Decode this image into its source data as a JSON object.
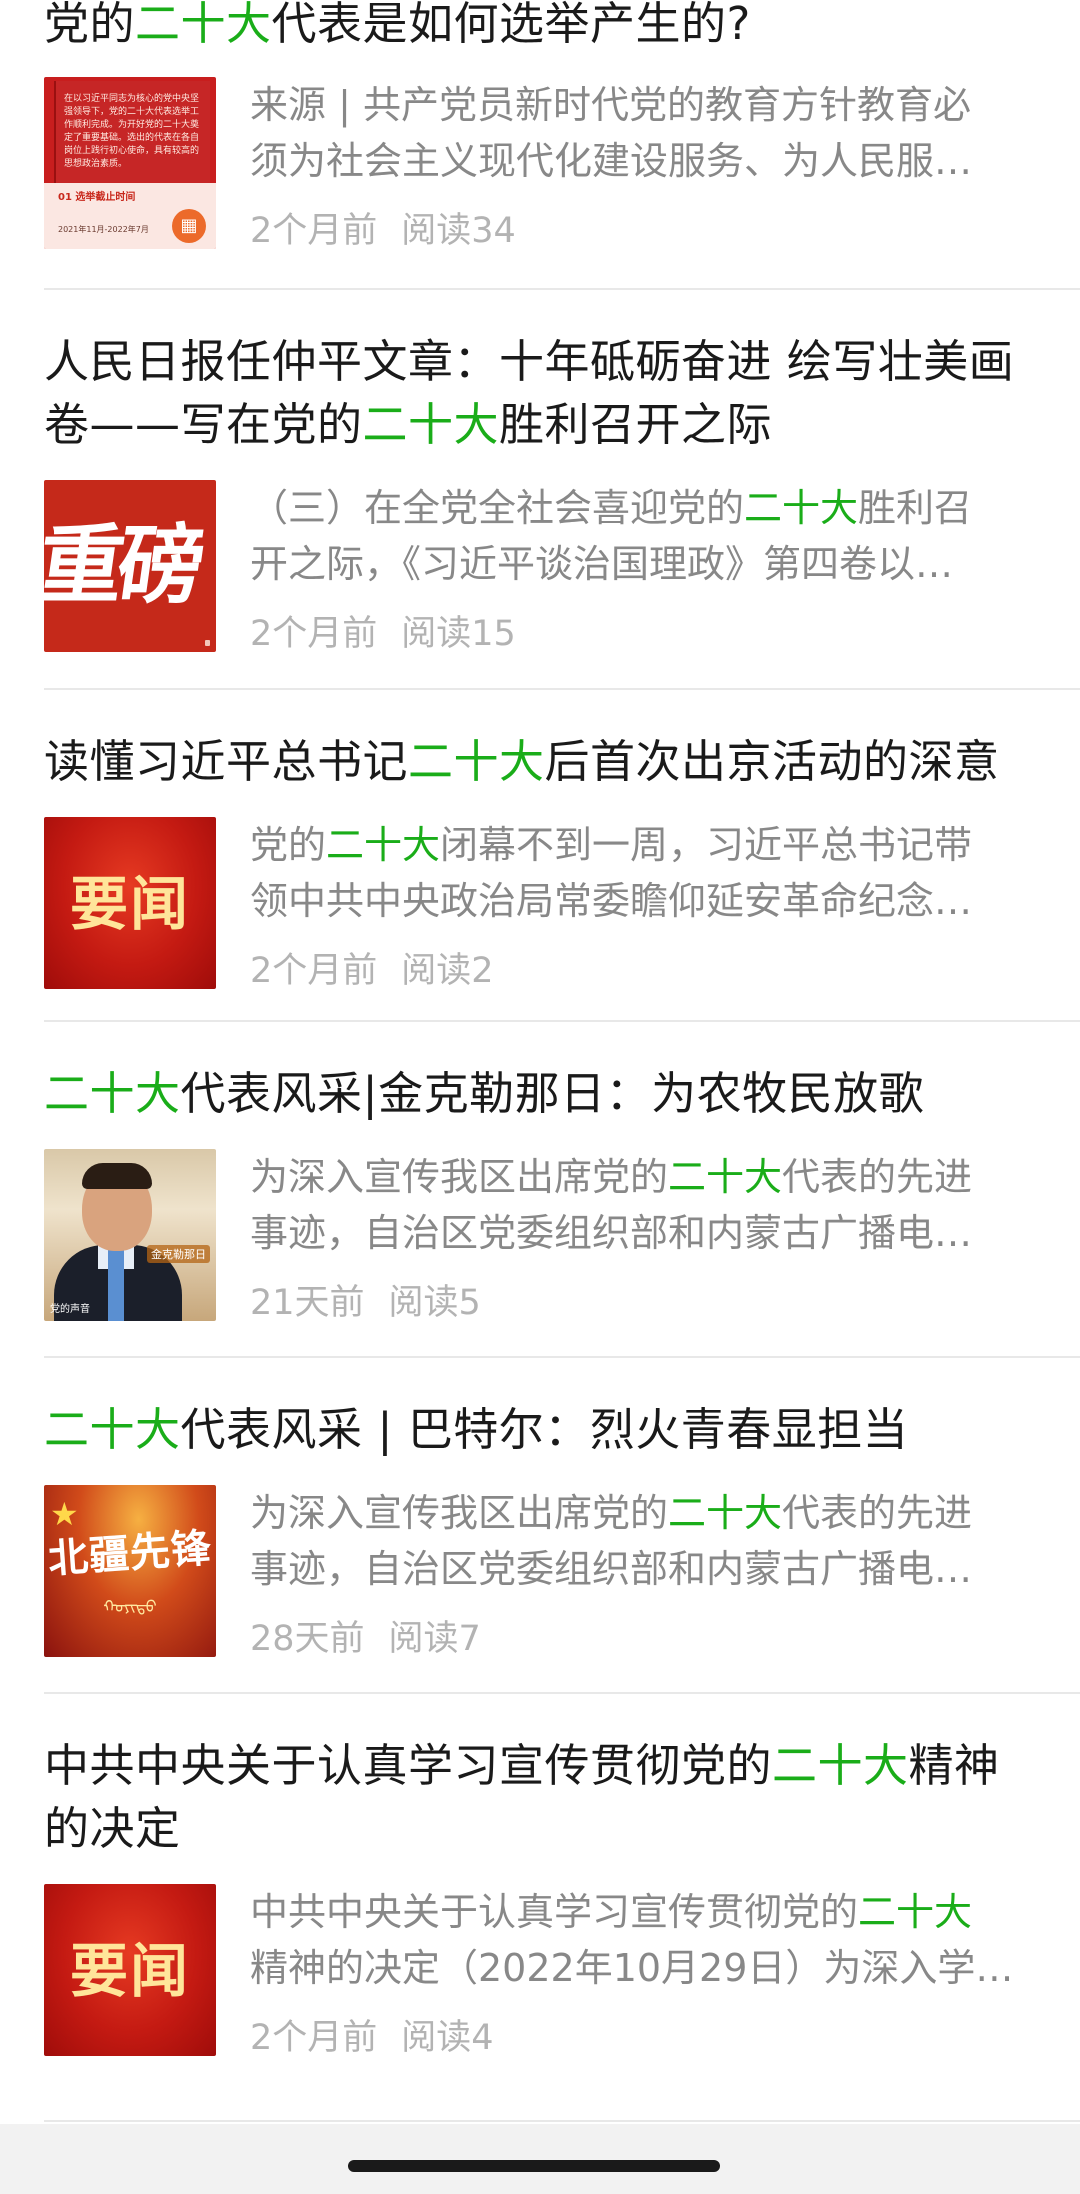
{
  "articles": [
    {
      "title_segments": [
        {
          "text": "党的",
          "hl": false
        },
        {
          "text": "二十大",
          "hl": true
        },
        {
          "text": "代表是如何选举产生的?",
          "hl": false
        }
      ],
      "digest_lines": [
        [
          {
            "text": "来源 | 共产党员新时代党的教育方针教育必",
            "hl": false
          }
        ],
        [
          {
            "text": "须为社会主义现代化建设服务、为人民服…",
            "hl": false
          }
        ]
      ],
      "time": "2个月前",
      "reads": "阅读34",
      "thumb_type": "doc",
      "thumb_text": {
        "body": "在以习近平同志为核心的党中央坚强领导下，党的二十大代表选举工作顺利完成。为开好党的二十大奠定了重要基础。选出的代表在各自岗位上践行初心使命，具有较高的思想政治素质。",
        "label": "01 选举截止时间",
        "date": "2021年11月-2022年7月"
      }
    },
    {
      "title_segments": [
        {
          "text": "人民日报任仲平文章：十年砥砺奋进 绘写壮美画卷——写在党的",
          "hl": false
        },
        {
          "text": "二十大",
          "hl": true
        },
        {
          "text": "胜利召开之际",
          "hl": false
        }
      ],
      "digest_lines": [
        [
          {
            "text": "（三）在全党全社会喜迎党的",
            "hl": false
          },
          {
            "text": "二十大",
            "hl": true
          },
          {
            "text": "胜利召",
            "hl": false
          }
        ],
        [
          {
            "text": "开之际，《习近平谈治国理政》第四卷以…",
            "hl": false
          }
        ]
      ],
      "time": "2个月前",
      "reads": "阅读15",
      "thumb_type": "heavy",
      "thumb_text": {
        "big": "重磅"
      }
    },
    {
      "title_segments": [
        {
          "text": "读懂习近平总书记",
          "hl": false
        },
        {
          "text": "二十大",
          "hl": true
        },
        {
          "text": "后首次出京活动的深意",
          "hl": false
        }
      ],
      "digest_lines": [
        [
          {
            "text": "党的",
            "hl": false
          },
          {
            "text": "二十大",
            "hl": true
          },
          {
            "text": "闭幕不到一周，习近平总书记带",
            "hl": false
          }
        ],
        [
          {
            "text": "领中共中央政治局常委瞻仰延安革命纪念…",
            "hl": false
          }
        ]
      ],
      "time": "2个月前",
      "reads": "阅读2",
      "thumb_type": "news",
      "thumb_text": {
        "big": "要闻"
      }
    },
    {
      "title_segments": [
        {
          "text": "二十大",
          "hl": true
        },
        {
          "text": "代表风采|金克勒那日：为农牧民放歌",
          "hl": false
        }
      ],
      "digest_lines": [
        [
          {
            "text": "为深入宣传我区出席党的",
            "hl": false
          },
          {
            "text": "二十大",
            "hl": true
          },
          {
            "text": "代表的先进",
            "hl": false
          }
        ],
        [
          {
            "text": "事迹，自治区党委组织部和内蒙古广播电…",
            "hl": false
          }
        ]
      ],
      "time": "21天前",
      "reads": "阅读5",
      "thumb_type": "person",
      "thumb_text": {
        "tag": "金克勒那日",
        "sub": "党的声音"
      }
    },
    {
      "title_segments": [
        {
          "text": "二十大",
          "hl": true
        },
        {
          "text": "代表风采 | 巴特尔：烈火青春显担当",
          "hl": false
        }
      ],
      "digest_lines": [
        [
          {
            "text": "为深入宣传我区出席党的",
            "hl": false
          },
          {
            "text": "二十大",
            "hl": true
          },
          {
            "text": "代表的先进",
            "hl": false
          }
        ],
        [
          {
            "text": "事迹，自治区党委组织部和内蒙古广播电…",
            "hl": false
          }
        ]
      ],
      "time": "28天前",
      "reads": "阅读7",
      "thumb_type": "pioneer",
      "thumb_text": {
        "big": "北疆先锋",
        "mongol": "ᠬᠣᠶᠢᠳᠤ"
      }
    },
    {
      "title_segments": [
        {
          "text": "中共中央关于认真学习宣传贯彻党的",
          "hl": false
        },
        {
          "text": "二十大",
          "hl": true
        },
        {
          "text": "精神的决定",
          "hl": false
        }
      ],
      "digest_lines": [
        [
          {
            "text": "中共中央关于认真学习宣传贯彻党的",
            "hl": false
          },
          {
            "text": "二十大",
            "hl": true
          }
        ],
        [
          {
            "text": "精神的决定（2022年10月29日）为深入学…",
            "hl": false
          }
        ]
      ],
      "time": "2个月前",
      "reads": "阅读4",
      "thumb_type": "news",
      "thumb_text": {
        "big": "要闻"
      }
    }
  ],
  "colors": {
    "highlight": "#1aad19",
    "title": "#1a1a1a",
    "digest": "#888888",
    "stats": "#b3b3b3",
    "divider": "#e8e8e8"
  },
  "icons": {
    "calendar": "calendar-icon",
    "emblem": "party-emblem-icon"
  }
}
